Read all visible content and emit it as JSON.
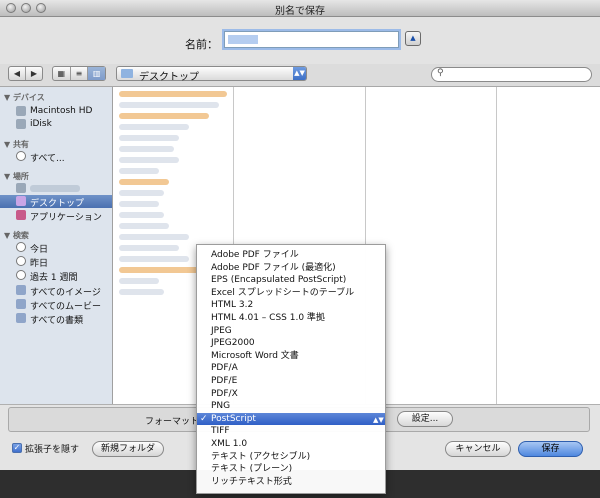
{
  "window": {
    "title": "別名で保存"
  },
  "save_name": {
    "label": "名前：",
    "value": ""
  },
  "toolbar": {
    "path_popup": "デスクトップ",
    "search_placeholder": ""
  },
  "sidebar": {
    "sections": {
      "devices": "デバイス",
      "shared": "共有",
      "places": "場所",
      "search": "検索"
    },
    "devices": [
      "Macintosh HD",
      "iDisk"
    ],
    "shared": [
      "すべて..."
    ],
    "places": [
      "デスクトップ",
      "アプリケーション"
    ],
    "search": [
      "今日",
      "昨日",
      "過去 1 週間",
      "すべてのイメージ",
      "すべてのムービー",
      "すべての書類"
    ]
  },
  "format": {
    "label": "フォーマット",
    "settings_button": "設定...",
    "options": [
      "Adobe PDF ファイル",
      "Adobe PDF ファイル (最適化)",
      "EPS (Encapsulated PostScript)",
      "Excel スプレッドシートのテーブル",
      "HTML 3.2",
      "HTML 4.01 – CSS 1.0 準拠",
      "JPEG",
      "JPEG2000",
      "Microsoft Word 文書",
      "PDF/A",
      "PDF/E",
      "PDF/X",
      "PNG",
      "PostScript",
      "TIFF",
      "XML 1.0",
      "テキスト (アクセシブル)",
      "テキスト (プレーン)",
      "リッチテキスト形式"
    ],
    "selected": "PostScript"
  },
  "bottom": {
    "hide_extension": "拡張子を隠す",
    "new_folder": "新規フォルダ",
    "cancel": "キャンセル",
    "save": "保存"
  }
}
